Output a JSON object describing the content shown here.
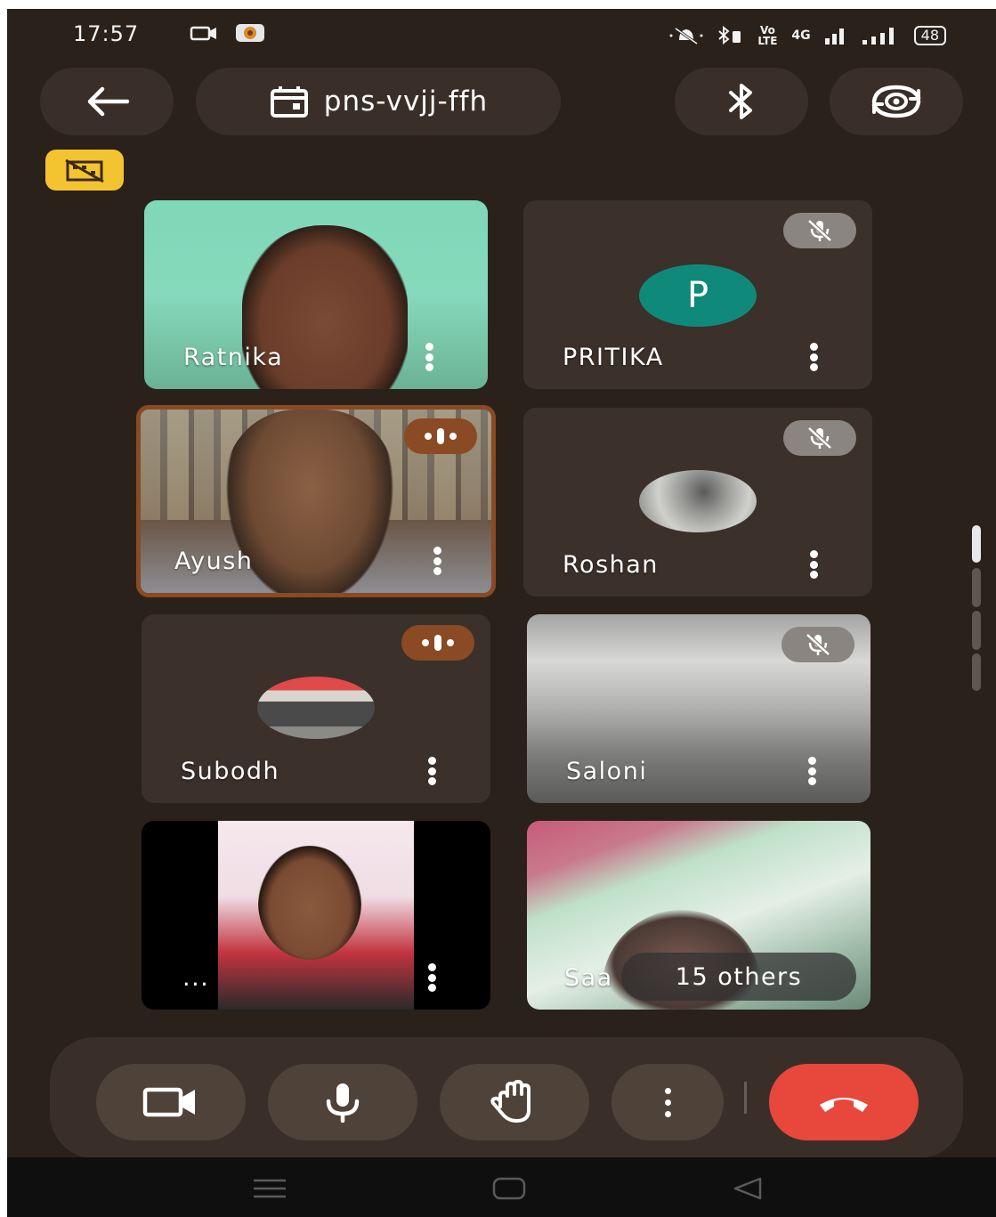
{
  "status_bar": {
    "time": "17:57",
    "network_label": "Vo LTE",
    "signal_label": "4G",
    "battery": "48"
  },
  "header": {
    "meeting_code": "pns-vvjj-ffh",
    "icons": [
      "back-arrow-icon",
      "calendar-icon",
      "bluetooth-icon",
      "switch-camera-icon"
    ]
  },
  "participants": [
    {
      "name": "Ratnika",
      "muted": false,
      "speaking": false,
      "type": "video"
    },
    {
      "name": "PRITIKA",
      "muted": true,
      "speaking": false,
      "type": "initial",
      "initial": "P",
      "avatar_color": "#0f8a7a"
    },
    {
      "name": "Ayush",
      "muted": false,
      "speaking": true,
      "type": "video"
    },
    {
      "name": "Roshan",
      "muted": true,
      "speaking": false,
      "type": "photo"
    },
    {
      "name": "Subodh",
      "muted": false,
      "speaking": true,
      "type": "photo"
    },
    {
      "name": "Saloni",
      "muted": true,
      "speaking": false,
      "type": "video"
    },
    {
      "name": "...",
      "muted": false,
      "speaking": false,
      "type": "video"
    },
    {
      "name": "Saa",
      "muted": false,
      "speaking": false,
      "type": "video"
    }
  ],
  "others_label": "15 others",
  "controls": {
    "icons": [
      "video-camera-icon",
      "microphone-icon",
      "raise-hand-icon",
      "more-options-icon",
      "end-call-icon"
    ],
    "end_call_color": "#e8473c"
  },
  "colors": {
    "background": "#2a211b",
    "tile": "#3b302a",
    "speaking_border": "#8a4a24",
    "badge": "#f4c430"
  }
}
